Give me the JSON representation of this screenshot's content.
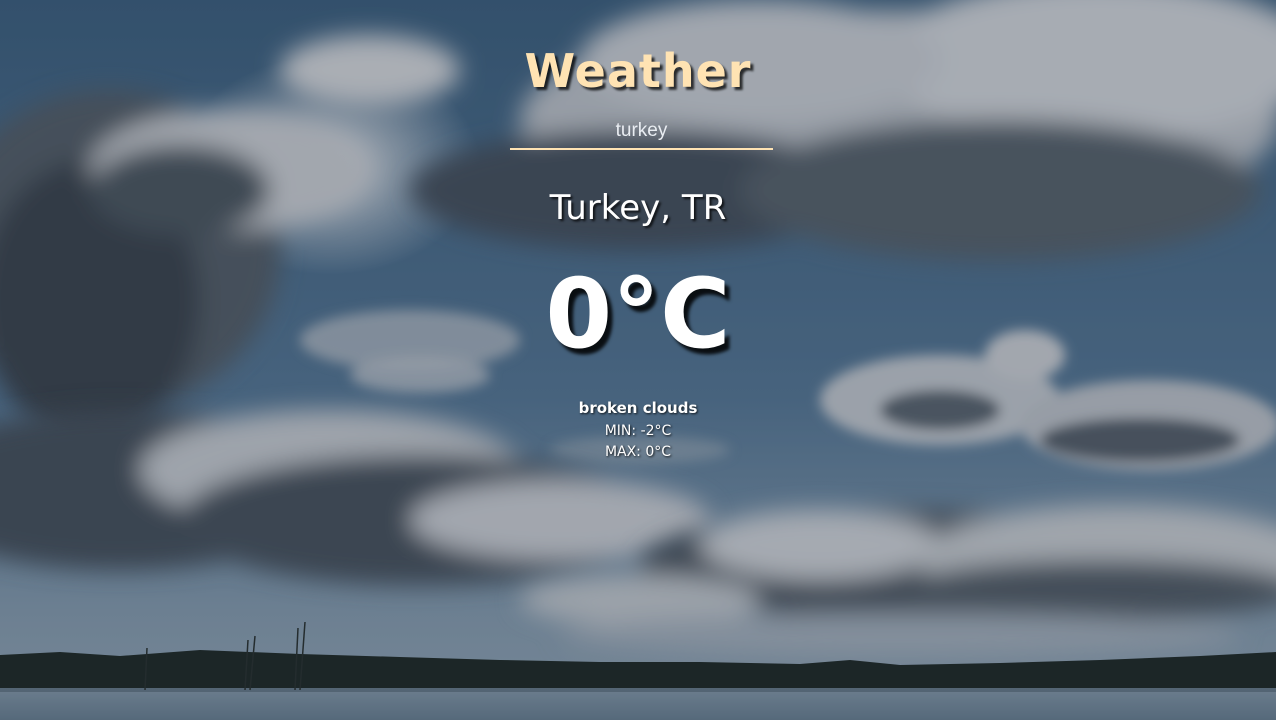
{
  "app": {
    "title": "Weather"
  },
  "search": {
    "value": "turkey"
  },
  "weather": {
    "location": "Turkey, TR",
    "temperature": "0°C",
    "description": "broken clouds",
    "min_label": "MIN:",
    "min_value": "-2°C",
    "max_label": "MAX:",
    "max_value": "0°C"
  },
  "background": {
    "scene": "cloudy sky over lake",
    "sky_color": "#4f7391",
    "cloud_color": "#dfe3e6",
    "accent_color": "#ffe3b3"
  }
}
